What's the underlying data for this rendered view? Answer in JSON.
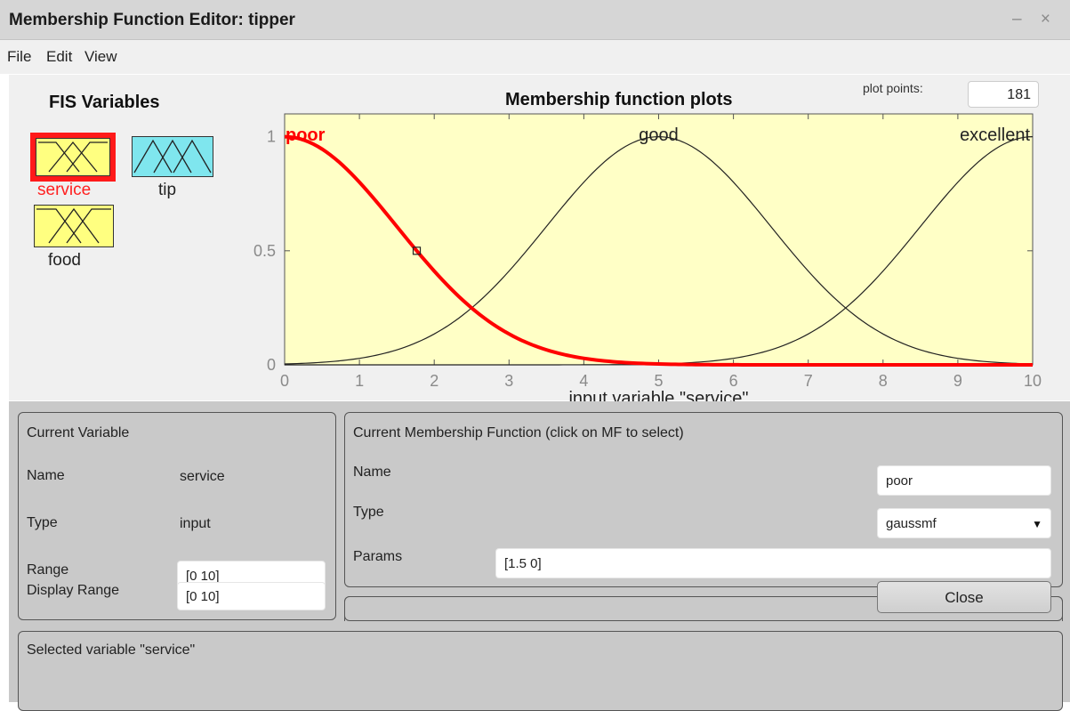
{
  "window": {
    "title": "Membership Function Editor: tipper",
    "controls": "– ×"
  },
  "menu": [
    "File",
    "Edit",
    "View"
  ],
  "fis_variables": {
    "title": "FIS Variables",
    "items": [
      {
        "label": "service",
        "color": "#ffff80",
        "selected": true,
        "icon": "input-mf-icon"
      },
      {
        "label": "tip",
        "color": "#7fe6ee",
        "selected": false,
        "icon": "output-mf-icon"
      },
      {
        "label": "food",
        "color": "#ffff80",
        "selected": false,
        "icon": "input-mf-icon"
      }
    ]
  },
  "plot": {
    "title": "Membership function plots",
    "plot_points_label": "plot points:",
    "plot_points_value": "181"
  },
  "chart_data": {
    "type": "line",
    "title": "Membership function plots",
    "xlabel": "input variable \"service\"",
    "ylabel": "",
    "xlim": [
      0,
      10
    ],
    "ylim": [
      0,
      1.1
    ],
    "xticks": [
      0,
      1,
      2,
      3,
      4,
      5,
      6,
      7,
      8,
      9,
      10
    ],
    "yticks": [
      0,
      0.5,
      1
    ],
    "ytick_labels": [
      "0",
      "0.5",
      "1"
    ],
    "background": "#ffffc6",
    "grid": false,
    "series": [
      {
        "name": "poor",
        "function": "gaussmf",
        "sigma": 1.5,
        "center": 0,
        "color": "#ff0000",
        "selected": true
      },
      {
        "name": "good",
        "function": "gaussmf",
        "sigma": 1.5,
        "center": 5,
        "color": "#222222",
        "selected": false
      },
      {
        "name": "excellent",
        "function": "gaussmf",
        "sigma": 1.5,
        "center": 10,
        "color": "#222222",
        "selected": false
      }
    ]
  },
  "current_variable": {
    "title": "Current Variable",
    "name_label": "Name",
    "name_value": "service",
    "type_label": "Type",
    "type_value": "input",
    "range_label": "Range",
    "range_value": "[0 10]",
    "display_range_label": "Display Range",
    "display_range_value": "[0 10]"
  },
  "current_mf": {
    "title": "Current Membership Function (click on MF to select)",
    "name_label": "Name",
    "name_value": "poor",
    "type_label": "Type",
    "type_value": "gaussmf",
    "params_label": "Params",
    "params_value": "[1.5 0]"
  },
  "close_label": "Close",
  "status": "Selected variable \"service\""
}
